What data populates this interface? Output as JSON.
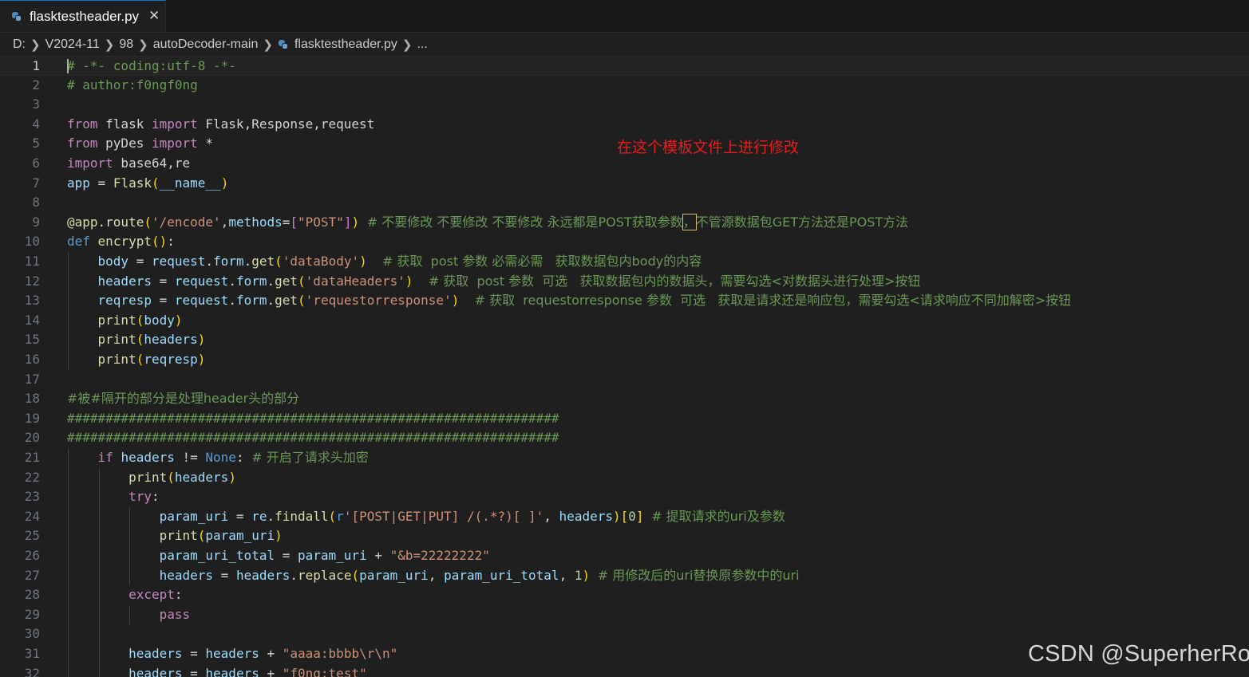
{
  "tab": {
    "label": "flasktestheader.py",
    "close": "✕"
  },
  "breadcrumb": [
    "D:",
    "V2024-11",
    "98",
    "autoDecoder-main",
    "flasktestheader.py",
    "..."
  ],
  "annotation": "在这个模板文件上进行修改",
  "watermark": "CSDN @SuperherRo",
  "lines": [
    {
      "n": "1",
      "parts": [
        [
          "cm",
          "# -*- coding:utf-8 -*-"
        ]
      ]
    },
    {
      "n": "2",
      "parts": [
        [
          "cm",
          "# author:f0ngf0ng"
        ]
      ]
    },
    {
      "n": "3",
      "parts": []
    },
    {
      "n": "4",
      "parts": [
        [
          "ctl",
          "from"
        ],
        [
          "",
          " flask "
        ],
        [
          "ctl",
          "import"
        ],
        [
          "",
          " Flask,Response,request"
        ]
      ]
    },
    {
      "n": "5",
      "parts": [
        [
          "ctl",
          "from"
        ],
        [
          "",
          " pyDes "
        ],
        [
          "ctl",
          "import"
        ],
        [
          "",
          " *"
        ]
      ]
    },
    {
      "n": "6",
      "parts": [
        [
          "ctl",
          "import"
        ],
        [
          "",
          " base64,re"
        ]
      ]
    },
    {
      "n": "7",
      "parts": [
        [
          "var",
          "app"
        ],
        [
          "",
          " = "
        ],
        [
          "fn",
          "Flask"
        ],
        [
          "br1",
          "("
        ],
        [
          "var",
          "__name__"
        ],
        [
          "br1",
          ")"
        ]
      ]
    },
    {
      "n": "8",
      "parts": []
    },
    {
      "n": "9",
      "parts": [
        [
          "fn",
          "@app.route"
        ],
        [
          "br1",
          "("
        ],
        [
          "str",
          "'/encode'"
        ],
        [
          "",
          ","
        ],
        [
          "var",
          "methods"
        ],
        [
          "",
          "="
        ],
        [
          "br2",
          "["
        ],
        [
          "str",
          "\"POST\""
        ],
        [
          "br2",
          "]"
        ],
        [
          "br1",
          ")"
        ],
        [
          "",
          " "
        ],
        [
          "cm",
          "# 不要修改 不要修改 不要修改 永远都是POST获取参数"
        ],
        [
          "cmbox",
          "，"
        ],
        [
          "cm",
          "不管源数据包GET方法还是POST方法"
        ]
      ]
    },
    {
      "n": "10",
      "parts": [
        [
          "kw",
          "def"
        ],
        [
          "",
          " "
        ],
        [
          "fn",
          "encrypt"
        ],
        [
          "br1",
          "()"
        ],
        [
          "",
          ":"
        ]
      ]
    },
    {
      "n": "11",
      "parts": [
        [
          "",
          "    "
        ],
        [
          "var",
          "body"
        ],
        [
          "",
          " = "
        ],
        [
          "var",
          "request"
        ],
        [
          "",
          "."
        ],
        [
          "var",
          "form"
        ],
        [
          "",
          "."
        ],
        [
          "fn",
          "get"
        ],
        [
          "br1",
          "("
        ],
        [
          "str",
          "'dataBody'"
        ],
        [
          "br1",
          ")"
        ],
        [
          "",
          "  "
        ],
        [
          "cm",
          "# 获取  post 参数 必需必需   获取数据包内body的内容"
        ]
      ]
    },
    {
      "n": "12",
      "parts": [
        [
          "",
          "    "
        ],
        [
          "var",
          "headers"
        ],
        [
          "",
          " = "
        ],
        [
          "var",
          "request"
        ],
        [
          "",
          "."
        ],
        [
          "var",
          "form"
        ],
        [
          "",
          "."
        ],
        [
          "fn",
          "get"
        ],
        [
          "br1",
          "("
        ],
        [
          "str",
          "'dataHeaders'"
        ],
        [
          "br1",
          ")"
        ],
        [
          "",
          "  "
        ],
        [
          "cm",
          "# 获取  post 参数  可选   获取数据包内的数据头，需要勾选<对数据头进行处理>按钮"
        ]
      ]
    },
    {
      "n": "13",
      "parts": [
        [
          "",
          "    "
        ],
        [
          "var",
          "reqresp"
        ],
        [
          "",
          " = "
        ],
        [
          "var",
          "request"
        ],
        [
          "",
          "."
        ],
        [
          "var",
          "form"
        ],
        [
          "",
          "."
        ],
        [
          "fn",
          "get"
        ],
        [
          "br1",
          "("
        ],
        [
          "str",
          "'requestorresponse'"
        ],
        [
          "br1",
          ")"
        ],
        [
          "",
          "  "
        ],
        [
          "cm",
          "# 获取  requestorresponse 参数  可选   获取是请求还是响应包，需要勾选<请求响应不同加解密>按钮"
        ]
      ]
    },
    {
      "n": "14",
      "parts": [
        [
          "",
          "    "
        ],
        [
          "fn",
          "print"
        ],
        [
          "br1",
          "("
        ],
        [
          "var",
          "body"
        ],
        [
          "br1",
          ")"
        ]
      ]
    },
    {
      "n": "15",
      "parts": [
        [
          "",
          "    "
        ],
        [
          "fn",
          "print"
        ],
        [
          "br1",
          "("
        ],
        [
          "var",
          "headers"
        ],
        [
          "br1",
          ")"
        ]
      ]
    },
    {
      "n": "16",
      "parts": [
        [
          "",
          "    "
        ],
        [
          "fn",
          "print"
        ],
        [
          "br1",
          "("
        ],
        [
          "var",
          "reqresp"
        ],
        [
          "br1",
          ")"
        ]
      ]
    },
    {
      "n": "17",
      "parts": []
    },
    {
      "n": "18",
      "parts": [
        [
          "cm",
          "#被#隔开的部分是处理header头的部分"
        ]
      ]
    },
    {
      "n": "19",
      "parts": [
        [
          "cm",
          "################################################################"
        ]
      ]
    },
    {
      "n": "20",
      "parts": [
        [
          "cm",
          "################################################################"
        ]
      ]
    },
    {
      "n": "21",
      "parts": [
        [
          "",
          "    "
        ],
        [
          "ctl",
          "if"
        ],
        [
          "",
          " "
        ],
        [
          "var",
          "headers"
        ],
        [
          "",
          " != "
        ],
        [
          "kw",
          "None"
        ],
        [
          "",
          ": "
        ],
        [
          "cm",
          "# 开启了请求头加密"
        ]
      ]
    },
    {
      "n": "22",
      "parts": [
        [
          "",
          "        "
        ],
        [
          "fn",
          "print"
        ],
        [
          "br1",
          "("
        ],
        [
          "var",
          "headers"
        ],
        [
          "br1",
          ")"
        ]
      ]
    },
    {
      "n": "23",
      "parts": [
        [
          "",
          "        "
        ],
        [
          "ctl",
          "try"
        ],
        [
          "",
          ":"
        ]
      ]
    },
    {
      "n": "24",
      "parts": [
        [
          "",
          "            "
        ],
        [
          "var",
          "param_uri"
        ],
        [
          "",
          " = "
        ],
        [
          "var",
          "re"
        ],
        [
          "",
          "."
        ],
        [
          "fn",
          "findall"
        ],
        [
          "br1",
          "("
        ],
        [
          "kw",
          "r"
        ],
        [
          "str",
          "'[POST|GET|PUT] /(.*?)[ ]'"
        ],
        [
          "",
          ", "
        ],
        [
          "var",
          "headers"
        ],
        [
          "br1",
          ")"
        ],
        [
          "br1",
          "["
        ],
        [
          "num",
          "0"
        ],
        [
          "br1",
          "]"
        ],
        [
          "",
          " "
        ],
        [
          "cm",
          "# 提取请求的uri及参数"
        ]
      ]
    },
    {
      "n": "25",
      "parts": [
        [
          "",
          "            "
        ],
        [
          "fn",
          "print"
        ],
        [
          "br1",
          "("
        ],
        [
          "var",
          "param_uri"
        ],
        [
          "br1",
          ")"
        ]
      ]
    },
    {
      "n": "26",
      "parts": [
        [
          "",
          "            "
        ],
        [
          "var",
          "param_uri_total"
        ],
        [
          "",
          " = "
        ],
        [
          "var",
          "param_uri"
        ],
        [
          "",
          " + "
        ],
        [
          "str",
          "\"&b=22222222\""
        ]
      ]
    },
    {
      "n": "27",
      "parts": [
        [
          "",
          "            "
        ],
        [
          "var",
          "headers"
        ],
        [
          "",
          " = "
        ],
        [
          "var",
          "headers"
        ],
        [
          "",
          "."
        ],
        [
          "fn",
          "replace"
        ],
        [
          "br1",
          "("
        ],
        [
          "var",
          "param_uri"
        ],
        [
          "",
          ", "
        ],
        [
          "var",
          "param_uri_total"
        ],
        [
          "",
          ", "
        ],
        [
          "num",
          "1"
        ],
        [
          "br1",
          ")"
        ],
        [
          "",
          " "
        ],
        [
          "cm",
          "# 用修改后的uri替换原参数中的uri"
        ]
      ]
    },
    {
      "n": "28",
      "parts": [
        [
          "",
          "        "
        ],
        [
          "ctl",
          "except"
        ],
        [
          "",
          ":"
        ]
      ]
    },
    {
      "n": "29",
      "parts": [
        [
          "",
          "            "
        ],
        [
          "ctl",
          "pass"
        ]
      ]
    },
    {
      "n": "30",
      "parts": []
    },
    {
      "n": "31",
      "parts": [
        [
          "",
          "        "
        ],
        [
          "var",
          "headers"
        ],
        [
          "",
          " = "
        ],
        [
          "var",
          "headers"
        ],
        [
          "",
          " + "
        ],
        [
          "str",
          "\"aaaa:bbbb\\r\\n\""
        ]
      ]
    },
    {
      "n": "32",
      "parts": [
        [
          "",
          "        "
        ],
        [
          "var",
          "headers"
        ],
        [
          "",
          " = "
        ],
        [
          "var",
          "headers"
        ],
        [
          "",
          " + "
        ],
        [
          "str",
          "\"f0ng:test\""
        ]
      ]
    }
  ]
}
